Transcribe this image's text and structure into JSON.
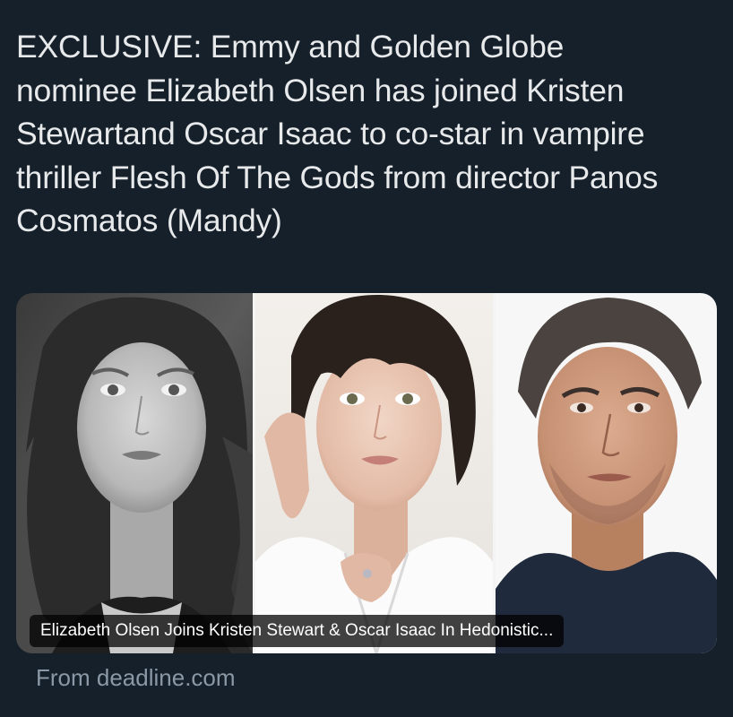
{
  "tweet": {
    "text": "EXCLUSIVE: Emmy and Golden Globe\nnominee Elizabeth Olsen has joined Kristen\nStewartand Oscar Isaac to co-star in vampire\nthriller Flesh Of The Gods from director Panos\nCosmatos (Mandy)"
  },
  "link_card": {
    "caption": "Elizabeth Olsen Joins Kristen Stewart & Oscar Isaac In Hedonistic...",
    "source": "From deadline.com"
  }
}
